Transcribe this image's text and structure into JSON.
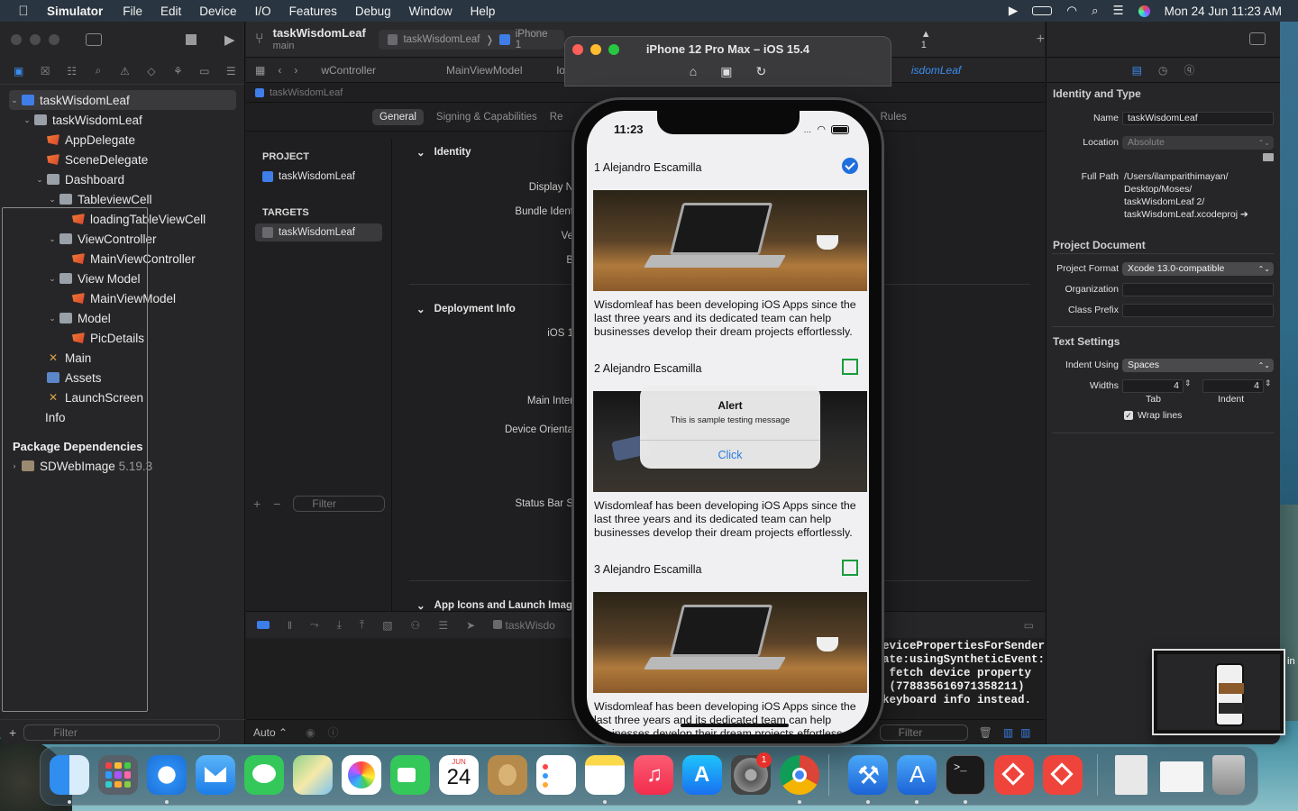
{
  "menubar": {
    "app_name": "Simulator",
    "items": [
      "File",
      "Edit",
      "Device",
      "I/O",
      "Features",
      "Debug",
      "Window",
      "Help"
    ],
    "clock": "Mon 24 Jun  11:23 AM"
  },
  "navigator": {
    "tree": [
      {
        "label": "taskWisdomLeaf",
        "icon": "project-icon",
        "level": 0,
        "chevron": "open",
        "selected": true
      },
      {
        "label": "taskWisdomLeaf",
        "icon": "folder-icon",
        "level": 1,
        "chevron": "open"
      },
      {
        "label": "AppDelegate",
        "icon": "swift-file-icon",
        "level": 2,
        "chevron": ""
      },
      {
        "label": "SceneDelegate",
        "icon": "swift-file-icon",
        "level": 2,
        "chevron": ""
      },
      {
        "label": "Dashboard",
        "icon": "folder-icon",
        "level": 2,
        "chevron": "open"
      },
      {
        "label": "TableviewCell",
        "icon": "folder-icon",
        "level": 3,
        "chevron": "open"
      },
      {
        "label": "loadingTableViewCell",
        "icon": "swift-file-icon",
        "level": 4,
        "chevron": ""
      },
      {
        "label": "ViewController",
        "icon": "folder-icon",
        "level": 3,
        "chevron": "open"
      },
      {
        "label": "MainViewController",
        "icon": "swift-file-icon",
        "level": 4,
        "chevron": ""
      },
      {
        "label": "View Model",
        "icon": "folder-icon",
        "level": 3,
        "chevron": "open"
      },
      {
        "label": "MainViewModel",
        "icon": "swift-file-icon",
        "level": 4,
        "chevron": ""
      },
      {
        "label": "Model",
        "icon": "folder-icon",
        "level": 3,
        "chevron": "open"
      },
      {
        "label": "PicDetails",
        "icon": "swift-file-icon",
        "level": 4,
        "chevron": ""
      },
      {
        "label": "Main",
        "icon": "storyboard-icon",
        "level": 2,
        "chevron": ""
      },
      {
        "label": "Assets",
        "icon": "assets-icon",
        "level": 2,
        "chevron": ""
      },
      {
        "label": "LaunchScreen",
        "icon": "storyboard-icon",
        "level": 2,
        "chevron": ""
      },
      {
        "label": "Info",
        "icon": "plist-icon",
        "level": 2,
        "chevron": ""
      }
    ],
    "packages_header": "Package Dependencies",
    "package_name": "SDWebImage",
    "package_version": "5.19.3",
    "filter_placeholder": "Filter"
  },
  "editor": {
    "project_title": "taskWisdomLeaf",
    "project_branch": "main",
    "scheme": "taskWisdomLeaf",
    "destination": "iPhone 1",
    "warning_count": "1",
    "jump_tabs": [
      "wController",
      "MainViewModel",
      "lo",
      "isdomLeaf"
    ],
    "breadcrumb": "taskWisdomLeaf",
    "segments": [
      "General",
      "Signing & Capabilities",
      "Re"
    ],
    "segment_tail": "Rules",
    "project_header": "PROJECT",
    "project_item": "taskWisdomLeaf",
    "targets_header": "TARGETS",
    "target_item": "taskWisdomLeaf",
    "list_filter_placeholder": "Filter",
    "sections": {
      "identity": "Identity",
      "deployment": "Deployment Info",
      "app_icons": "App Icons and Launch Imag"
    },
    "labels": {
      "display_name": "Display N",
      "bundle_id": "Bundle Ident",
      "version": "Ve",
      "build": "B",
      "ios": "iOS 1",
      "main_interface": "Main Inter",
      "device_orientation": "Device Orienta",
      "status_bar": "Status Bar S"
    },
    "debug_target": "taskWisdo",
    "console_text": "evicePropertiesForSender\nate:usingSyntheticEvent:\n fetch device property\n (778835616971358211)\nkeyboard info instead.",
    "console_mode": "Auto ⌃",
    "console_filter_placeholder": "Filter"
  },
  "inspector": {
    "identity_type_header": "Identity and Type",
    "name_label": "Name",
    "name_value": "taskWisdomLeaf",
    "location_label": "Location",
    "location_value": "Absolute",
    "full_path_label": "Full Path",
    "full_path_lines": [
      "/Users/ilamparithimayan/",
      "Desktop/Moses/",
      "taskWisdomLeaf 2/",
      "taskWisdomLeaf.xcodeproj"
    ],
    "project_document_header": "Project Document",
    "project_format_label": "Project Format",
    "project_format_value": "Xcode 13.0-compatible",
    "organization_label": "Organization",
    "class_prefix_label": "Class Prefix",
    "text_settings_header": "Text Settings",
    "indent_using_label": "Indent Using",
    "indent_using_value": "Spaces",
    "widths_label": "Widths",
    "tab_value": "4",
    "indent_value": "4",
    "tab_caption": "Tab",
    "indent_caption": "Indent",
    "wrap_lines_label": "Wrap lines"
  },
  "simulator": {
    "window_title": "iPhone 12 Pro Max – iOS 15.4",
    "status_time": "11:23",
    "cells": [
      {
        "title": "1 Alejandro Escamilla",
        "checked": true,
        "photo": "laptop-photo"
      },
      {
        "title": "2 Alejandro Escamilla",
        "checked": false,
        "photo": "desk-photo"
      },
      {
        "title": "3 Alejandro Escamilla",
        "checked": false,
        "photo": "laptop-photo"
      }
    ],
    "description": "Wisdomleaf has been developing iOS Apps since the last three years and its dedicated team can help businesses develop their dream projects effortlessly.",
    "description_partial": "Wisdomleaf has been developing iOS Apps since the last three years and its dedicated team can help businesses develop their dream projects effortless",
    "alert": {
      "title": "Alert",
      "message": "This is sample testing message",
      "button": "Click"
    }
  },
  "dock": {
    "apps": [
      "Finder",
      "Launchpad",
      "Safari",
      "Mail",
      "Messages",
      "Maps",
      "Photos",
      "FaceTime",
      "Calendar",
      "Contacts",
      "Reminders",
      "Notes",
      "Music",
      "App Store",
      "System Preferences",
      "Chrome",
      "Xcode",
      "Simulator",
      "Terminal",
      "AnyDesk",
      "AnyDesk"
    ],
    "calendar_month": "JUN",
    "calendar_day": "24",
    "settings_badge": "1"
  },
  "thumbnail_tail": "in"
}
